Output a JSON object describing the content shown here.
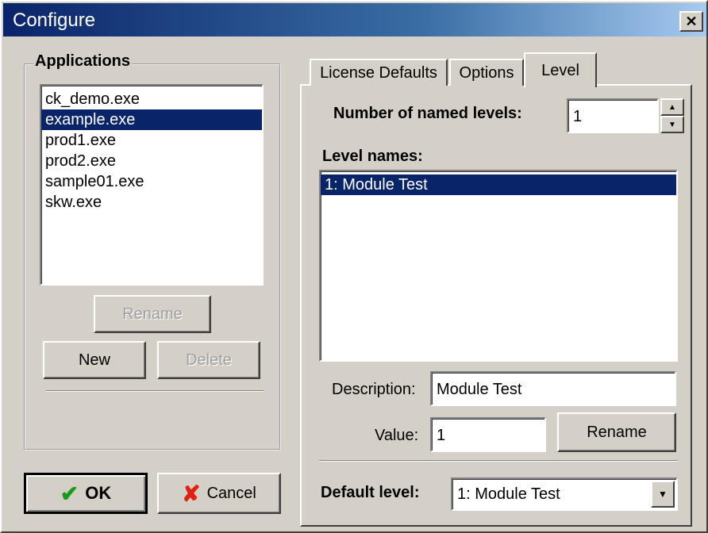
{
  "window": {
    "title": "Configure",
    "close_symbol": "✕"
  },
  "applications": {
    "legend": "Applications",
    "items": [
      "ck_demo.exe",
      "example.exe",
      "prod1.exe",
      "prod2.exe",
      "sample01.exe",
      "skw.exe"
    ],
    "selected_index": 1,
    "rename_label": "Rename",
    "new_label": "New",
    "delete_label": "Delete"
  },
  "buttons": {
    "ok_label": "OK",
    "cancel_label": "Cancel"
  },
  "tabs": [
    {
      "label": "License Defaults"
    },
    {
      "label": "Options"
    },
    {
      "label": "Level",
      "active": true
    }
  ],
  "level": {
    "named_levels_label": "Number of named levels:",
    "named_levels_value": "1",
    "level_names_label": "Level names:",
    "level_names": [
      "1:  Module Test"
    ],
    "description_label": "Description:",
    "description_value": "Module Test",
    "value_label": "Value:",
    "value_value": "1",
    "rename_label": "Rename",
    "default_level_label": "Default level:",
    "default_level_value": "1:  Module Test"
  },
  "colors": {
    "selection": "#0a246a",
    "ok_check": "#1a9a1a",
    "cancel_x": "#e02010"
  },
  "icons": {
    "ok": "checkmark-icon",
    "cancel": "x-icon",
    "close": "close-icon"
  }
}
